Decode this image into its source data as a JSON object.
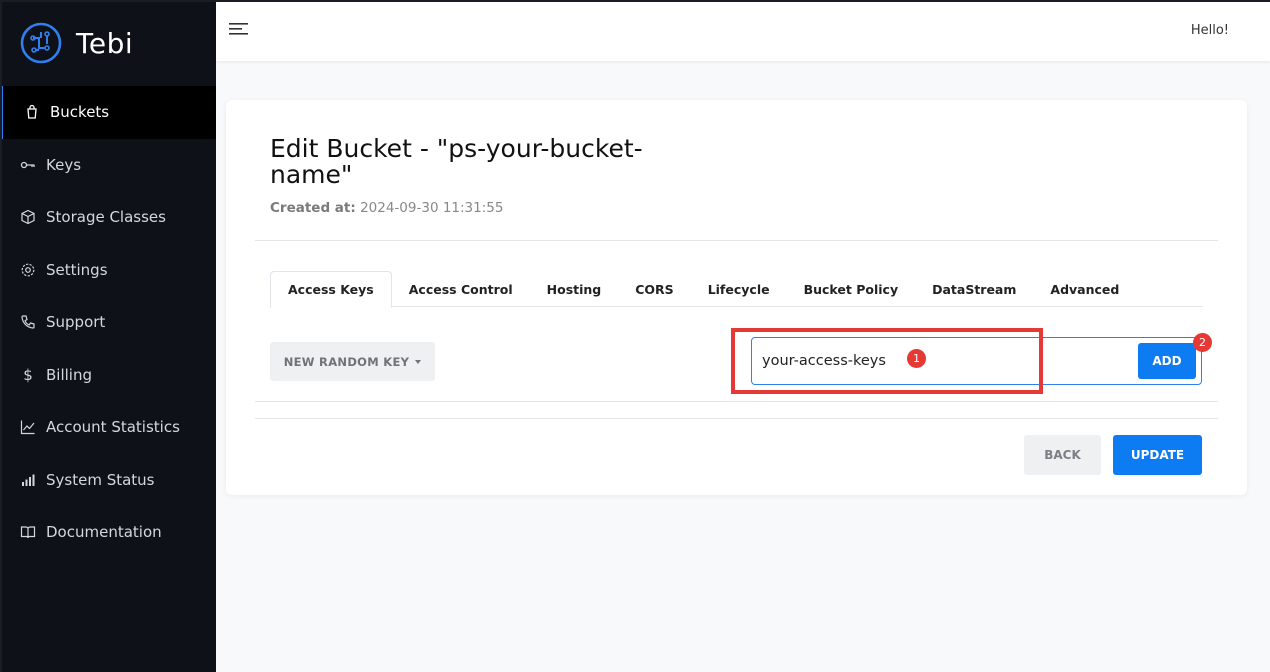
{
  "brand": {
    "name": "Tebi"
  },
  "sidebar": {
    "items": [
      {
        "label": "Buckets",
        "icon": "bucket-icon",
        "active": true
      },
      {
        "label": "Keys",
        "icon": "key-icon"
      },
      {
        "label": "Storage Classes",
        "icon": "cube-icon"
      },
      {
        "label": "Settings",
        "icon": "gear-icon"
      },
      {
        "label": "Support",
        "icon": "phone-icon"
      },
      {
        "label": "Billing",
        "icon": "dollar-icon"
      },
      {
        "label": "Account Statistics",
        "icon": "chart-line-icon"
      },
      {
        "label": "System Status",
        "icon": "signal-bars-icon"
      },
      {
        "label": "Documentation",
        "icon": "book-icon"
      }
    ]
  },
  "header": {
    "greeting": "Hello!"
  },
  "page": {
    "title": "Edit Bucket - \"ps-your-bucket-name\"",
    "created_label": "Created at:",
    "created_value": "2024-09-30 11:31:55"
  },
  "tabs": [
    {
      "label": "Access Keys",
      "active": true
    },
    {
      "label": "Access Control"
    },
    {
      "label": "Hosting"
    },
    {
      "label": "CORS"
    },
    {
      "label": "Lifecycle"
    },
    {
      "label": "Bucket Policy"
    },
    {
      "label": "DataStream"
    },
    {
      "label": "Advanced"
    }
  ],
  "access_keys": {
    "random_key_label": "NEW RANDOM KEY",
    "input_value": "your-access-keys",
    "add_label": "ADD"
  },
  "annotations": {
    "marker1": "1",
    "marker2": "2",
    "color": "#e53935"
  },
  "actions": {
    "back_label": "BACK",
    "update_label": "UPDATE"
  },
  "colors": {
    "accent": "#0d7bf2",
    "sidebar_bg": "#0e1117"
  }
}
